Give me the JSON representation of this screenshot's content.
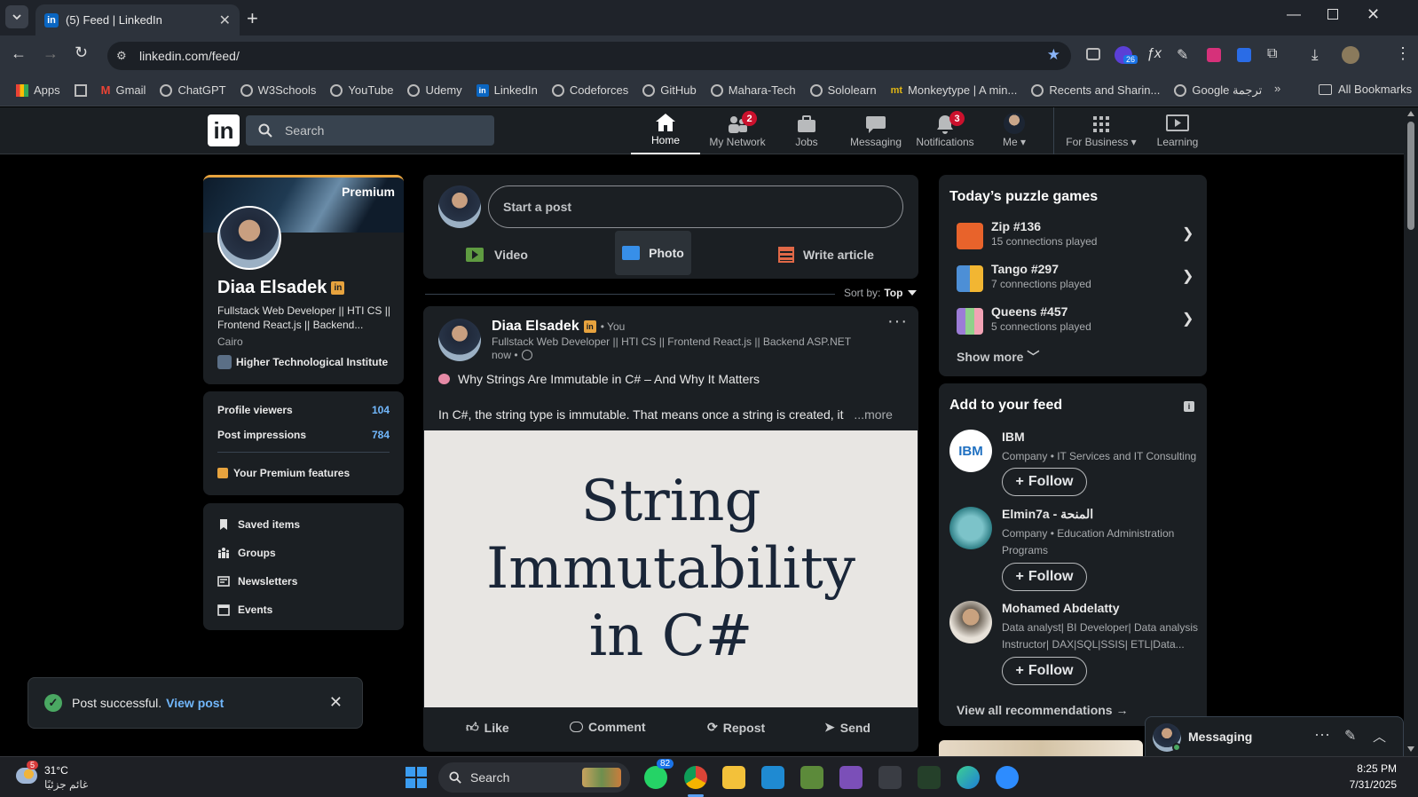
{
  "browser": {
    "tab_title": "(5) Feed | LinkedIn",
    "url": "linkedin.com/feed/",
    "extension_badge": "26",
    "bookmarks": [
      "Apps",
      "Gmail",
      "ChatGPT",
      "W3Schools",
      "YouTube",
      "Udemy",
      "LinkedIn",
      "Codeforces",
      "GitHub",
      "Mahara-Tech",
      "Sololearn",
      "Monkeytype | A min...",
      "Recents and Sharin...",
      "Google ترجمة"
    ],
    "all_bookmarks": "All Bookmarks"
  },
  "nav": {
    "search_placeholder": "Search",
    "items": [
      {
        "label": "Home",
        "badge": ""
      },
      {
        "label": "My Network",
        "badge": "2"
      },
      {
        "label": "Jobs",
        "badge": ""
      },
      {
        "label": "Messaging",
        "badge": ""
      },
      {
        "label": "Notifications",
        "badge": "3"
      },
      {
        "label": "Me",
        "badge": ""
      },
      {
        "label": "For Business",
        "badge": ""
      },
      {
        "label": "Learning",
        "badge": ""
      }
    ]
  },
  "profile": {
    "premium": "Premium",
    "name": "Diaa Elsadek",
    "headline": "Fullstack Web Developer || HTI CS || Frontend React.js || Backend...",
    "location": "Cairo",
    "school": "Higher Technological Institute",
    "stats": [
      {
        "label": "Profile viewers",
        "value": "104"
      },
      {
        "label": "Post impressions",
        "value": "784"
      }
    ],
    "premium_features": "Your Premium features",
    "links": [
      "Saved items",
      "Groups",
      "Newsletters",
      "Events"
    ]
  },
  "composer": {
    "placeholder": "Start a post",
    "actions": [
      "Video",
      "Photo",
      "Write article"
    ]
  },
  "sort": {
    "label": "Sort by:",
    "value": "Top"
  },
  "post": {
    "author": "Diaa Elsadek",
    "you": "• You",
    "headline": "Fullstack Web Developer || HTI CS || Frontend React.js || Backend ASP.NET",
    "time": "now •",
    "title": "Why Strings Are Immutable in C# – And Why It Matters",
    "body": "In C#, the string type is immutable. That means once a string is created, it",
    "more": "...more",
    "image_lines": [
      "String",
      "Immutability",
      "in C#"
    ],
    "actions": [
      "Like",
      "Comment",
      "Repost",
      "Send"
    ]
  },
  "toast": {
    "text": "Post successful.",
    "link": "View post"
  },
  "puzzles": {
    "title": "Today’s puzzle games",
    "games": [
      {
        "name": "Zip #136",
        "sub": "15 connections played",
        "color": "#e8632b"
      },
      {
        "name": "Tango #297",
        "sub": "7 connections played",
        "color": "#f2b632"
      },
      {
        "name": "Queens #457",
        "sub": "5 connections played",
        "color": "#9c7cd6"
      }
    ],
    "show_more": "Show more"
  },
  "feed_recs": {
    "title": "Add to your feed",
    "items": [
      {
        "name": "IBM",
        "sub": "Company • IT Services and IT Consulting"
      },
      {
        "name": "Elmin7a - المنحة",
        "sub": "Company • Education Administration Programs"
      },
      {
        "name": "Mohamed Abdelatty",
        "sub": "Data analyst| BI Developer| Data analysis Instructor| DAX|SQL|SSIS| ETL|Data..."
      }
    ],
    "follow": "Follow",
    "view_all": "View all recommendations"
  },
  "messaging": {
    "label": "Messaging"
  },
  "taskbar": {
    "weather_badge": "5",
    "temp": "31°C",
    "weather_desc": "غائم جزئيًا",
    "search": "Search",
    "whatsapp_badge": "82",
    "time": "8:25 PM",
    "date": "7/31/2025"
  },
  "colors": {
    "accent": "#71b7fb",
    "gold": "#e7a33e",
    "badge": "#cb112d",
    "green": "#4aa862"
  }
}
